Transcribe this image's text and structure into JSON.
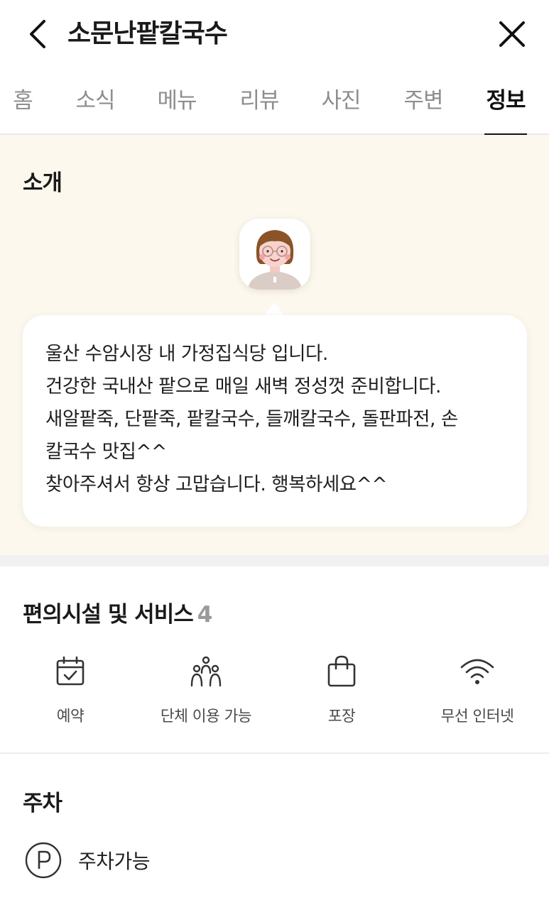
{
  "header": {
    "title": "소문난팥칼국수",
    "back_icon": "chevron-left-icon",
    "close_icon": "close-icon"
  },
  "tabs": [
    {
      "label": "홈",
      "active": false
    },
    {
      "label": "소식",
      "active": false
    },
    {
      "label": "메뉴",
      "active": false
    },
    {
      "label": "리뷰",
      "active": false
    },
    {
      "label": "사진",
      "active": false
    },
    {
      "label": "주변",
      "active": false
    },
    {
      "label": "정보",
      "active": true
    }
  ],
  "intro": {
    "title": "소개",
    "avatar_icon": "owner-avatar-icon",
    "lines": [
      "울산 수암시장 내 가정집식당 입니다.",
      "건강한 국내산 팥으로 매일 새벽 정성껏 준비합니다.",
      "새알팥죽, 단팥죽, 팥칼국수, 들깨칼국수, 돌판파전, 손",
      "칼국수 맛집^^",
      "찾아주셔서 항상 고맙습니다. 행복하세요^^"
    ]
  },
  "facilities": {
    "title": "편의시설 및 서비스",
    "count": "4",
    "items": [
      {
        "label": "예약",
        "icon": "calendar-check-icon"
      },
      {
        "label": "단체 이용 가능",
        "icon": "group-icon"
      },
      {
        "label": "포장",
        "icon": "shopping-bag-icon"
      },
      {
        "label": "무선 인터넷",
        "icon": "wifi-icon"
      }
    ]
  },
  "parking": {
    "title": "주차",
    "label": "주차가능",
    "icon": "parking-icon"
  },
  "colors": {
    "intro_bg": "#fdf8ee",
    "active_tab": "#111111",
    "inactive_tab": "#8e8e8e",
    "divider": "#f1f1f1"
  }
}
